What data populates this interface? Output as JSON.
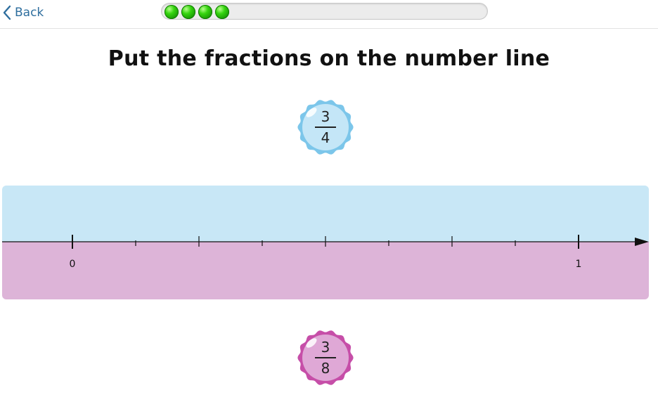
{
  "nav": {
    "back_label": "Back",
    "back_icon": "chevron-left-icon"
  },
  "progress": {
    "completed_steps": 4,
    "dot_color": "#2ecc0f"
  },
  "title": "Put the fractions on the number line",
  "fractions": {
    "top": {
      "numerator": "3",
      "denominator": "4",
      "color": "#7cc6ea"
    },
    "bottom": {
      "numerator": "3",
      "denominator": "8",
      "color": "#c64ea8"
    }
  },
  "number_line": {
    "start_label": "0",
    "end_label": "1",
    "start_value": 0,
    "end_value": 1,
    "divisions": 8,
    "top_zone_color": "#c8e7f6",
    "bottom_zone_color": "#ddb4d8"
  }
}
